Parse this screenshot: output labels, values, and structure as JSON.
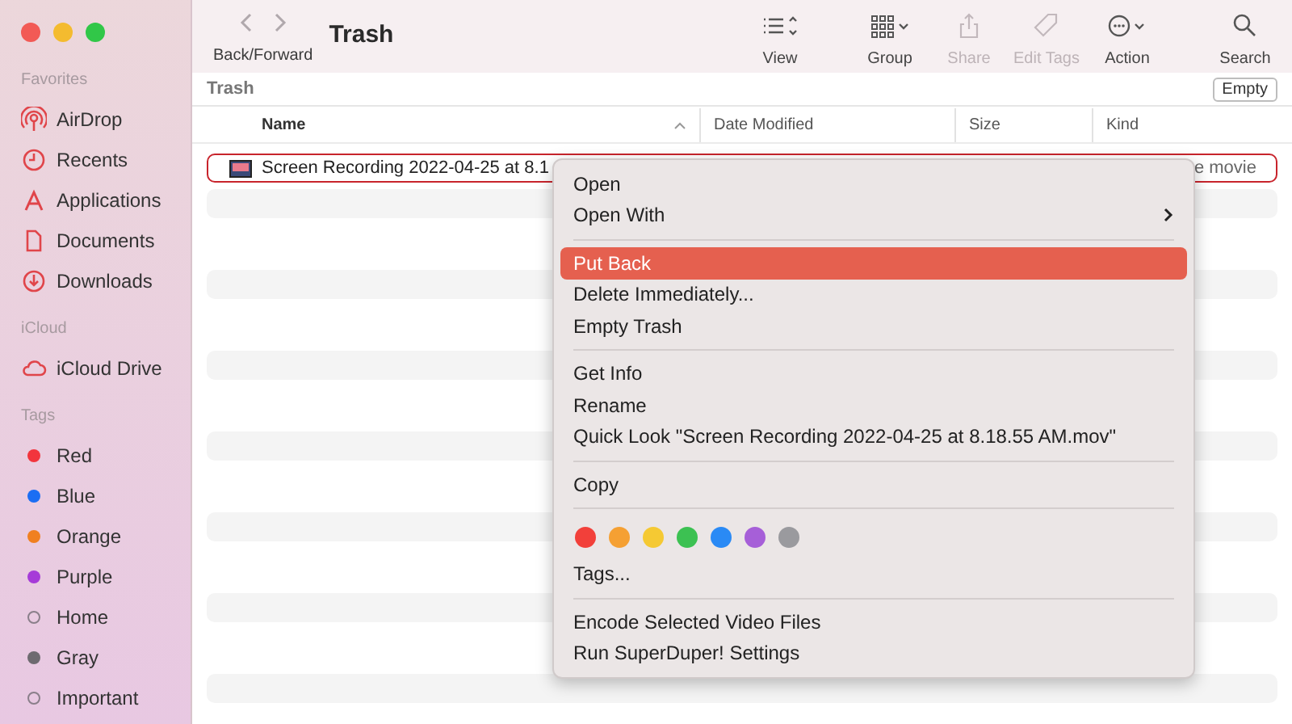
{
  "window": {
    "title": "Trash"
  },
  "sidebar": {
    "sections": [
      {
        "heading": "Favorites",
        "items": [
          {
            "label": "AirDrop"
          },
          {
            "label": "Recents"
          },
          {
            "label": "Applications"
          },
          {
            "label": "Documents"
          },
          {
            "label": "Downloads"
          }
        ]
      },
      {
        "heading": "iCloud",
        "items": [
          {
            "label": "iCloud Drive"
          }
        ]
      },
      {
        "heading": "Tags",
        "tags": [
          {
            "label": "Red",
            "color": "#f2353d",
            "hollow": false
          },
          {
            "label": "Blue",
            "color": "#1b6ef3",
            "hollow": false
          },
          {
            "label": "Orange",
            "color": "#f08020",
            "hollow": false
          },
          {
            "label": "Purple",
            "color": "#a63bd8",
            "hollow": false
          },
          {
            "label": "Home",
            "color": "#8a7f8a",
            "hollow": true
          },
          {
            "label": "Gray",
            "color": "#6e6a70",
            "hollow": false
          },
          {
            "label": "Important",
            "color": "#8a7f8a",
            "hollow": true
          }
        ]
      }
    ]
  },
  "toolbar": {
    "nav_label": "Back/Forward",
    "buttons": [
      {
        "label": "View",
        "disabled": false
      },
      {
        "label": "Group",
        "disabled": false
      },
      {
        "label": "Share",
        "disabled": true
      },
      {
        "label": "Edit Tags",
        "disabled": true
      },
      {
        "label": "Action",
        "disabled": false
      },
      {
        "label": "Search",
        "disabled": false
      }
    ]
  },
  "path_bar": {
    "title": "Trash",
    "button": "Empty"
  },
  "table": {
    "columns": [
      "Name",
      "Date Modified",
      "Size",
      "Kind"
    ],
    "rows": [
      {
        "name": "Screen Recording 2022-04-25 at 8.1",
        "kind": "e movie",
        "selected": true
      }
    ]
  },
  "context_menu": {
    "items": [
      {
        "kind": "item",
        "label": "Open",
        "submenu": false,
        "selected": false
      },
      {
        "kind": "item",
        "label": "Open With",
        "submenu": true,
        "selected": false
      },
      {
        "kind": "separator"
      },
      {
        "kind": "item",
        "label": "Put Back",
        "submenu": false,
        "selected": true
      },
      {
        "kind": "item",
        "label": "Delete Immediately...",
        "submenu": false,
        "selected": false
      },
      {
        "kind": "item",
        "label": "Empty Trash",
        "submenu": false,
        "selected": false
      },
      {
        "kind": "separator"
      },
      {
        "kind": "item",
        "label": "Get Info",
        "submenu": false,
        "selected": false
      },
      {
        "kind": "item",
        "label": "Rename",
        "submenu": false,
        "selected": false
      },
      {
        "kind": "item",
        "label": "Quick Look \"Screen Recording 2022-04-25 at 8.18.55 AM.mov\"",
        "submenu": false,
        "selected": false
      },
      {
        "kind": "separator"
      },
      {
        "kind": "item",
        "label": "Copy",
        "submenu": false,
        "selected": false
      },
      {
        "kind": "separator"
      },
      {
        "kind": "tags",
        "dots": [
          {
            "color": "#f2403a"
          },
          {
            "color": "#f5a033"
          },
          {
            "color": "#f5c933"
          },
          {
            "color": "#3cc152"
          },
          {
            "color": "#2a8af5"
          },
          {
            "color": "#a65fd8"
          },
          {
            "color": "#9a9a9e"
          }
        ]
      },
      {
        "kind": "item",
        "label": "Tags...",
        "submenu": false,
        "selected": false
      },
      {
        "kind": "separator"
      },
      {
        "kind": "item",
        "label": "Encode Selected Video Files",
        "submenu": false,
        "selected": false
      },
      {
        "kind": "item",
        "label": "Run SuperDuper! Settings",
        "submenu": false,
        "selected": false
      }
    ]
  }
}
